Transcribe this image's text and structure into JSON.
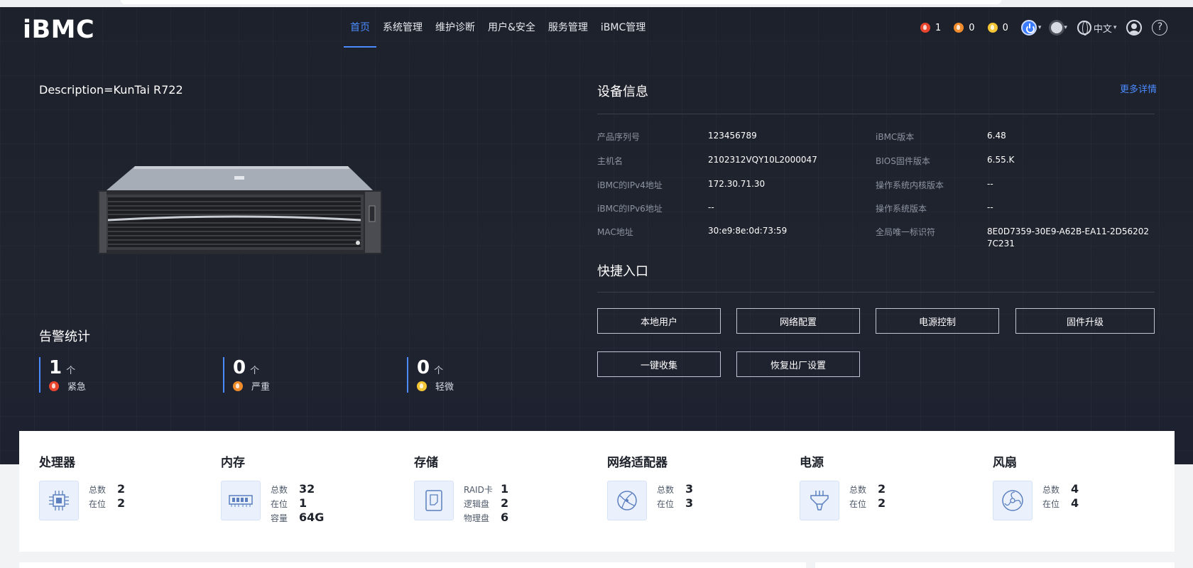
{
  "app": {
    "logo": "iBMC"
  },
  "nav": [
    {
      "label": "首页",
      "active": true
    },
    {
      "label": "系统管理"
    },
    {
      "label": "维护诊断"
    },
    {
      "label": "用户&安全"
    },
    {
      "label": "服务管理"
    },
    {
      "label": "iBMC管理"
    }
  ],
  "header_alarms": [
    {
      "count": "1",
      "color": "#e8452f"
    },
    {
      "count": "0",
      "color": "#f08c2b"
    },
    {
      "count": "0",
      "color": "#f4c534"
    }
  ],
  "header_tools": {
    "language": "中文",
    "help": "?"
  },
  "description": "Description=KunTai R722",
  "alarm_stats": {
    "title": "告警统计",
    "items": [
      {
        "count": "1",
        "unit": "个",
        "label": "紧急",
        "color": "#e8452f"
      },
      {
        "count": "0",
        "unit": "个",
        "label": "严重",
        "color": "#f08c2b"
      },
      {
        "count": "0",
        "unit": "个",
        "label": "轻微",
        "color": "#f4c534"
      }
    ]
  },
  "device_info": {
    "title": "设备信息",
    "more": "更多详情",
    "left": [
      {
        "label": "产品序列号",
        "value": "123456789"
      },
      {
        "label": "主机名",
        "value": "2102312VQY10L2000047"
      },
      {
        "label": "iBMC的IPv4地址",
        "value": "172.30.71.30"
      },
      {
        "label": "iBMC的IPv6地址",
        "value": "--"
      },
      {
        "label": "MAC地址",
        "value": "30:e9:8e:0d:73:59"
      }
    ],
    "right": [
      {
        "label": "iBMC版本",
        "value": "6.48"
      },
      {
        "label": "BIOS固件版本",
        "value": "6.55.K"
      },
      {
        "label": "操作系统内核版本",
        "value": "--"
      },
      {
        "label": "操作系统版本",
        "value": "--"
      },
      {
        "label": "全局唯一标识符",
        "value": "8E0D7359-30E9-A62B-EA11-2D562027C231"
      }
    ]
  },
  "quick_entry": {
    "title": "快捷入口",
    "buttons": [
      "本地用户",
      "网络配置",
      "电源控制",
      "固件升级",
      "一键收集",
      "恢复出厂设置"
    ]
  },
  "hardware": [
    {
      "title": "处理器",
      "icon": "cpu-icon",
      "stats": [
        {
          "k": "总数",
          "v": "2"
        },
        {
          "k": "在位",
          "v": "2"
        }
      ]
    },
    {
      "title": "内存",
      "icon": "memory-icon",
      "stats": [
        {
          "k": "总数",
          "v": "32"
        },
        {
          "k": "在位",
          "v": "1"
        },
        {
          "k": "容量",
          "v": "64G"
        }
      ]
    },
    {
      "title": "存储",
      "icon": "storage-icon",
      "stats": [
        {
          "k": "RAID卡",
          "v": "1"
        },
        {
          "k": "逻辑盘",
          "v": "2"
        },
        {
          "k": "物理盘",
          "v": "6"
        }
      ]
    },
    {
      "title": "网络适配器",
      "icon": "network-adapter-icon",
      "stats": [
        {
          "k": "总数",
          "v": "3"
        },
        {
          "k": "在位",
          "v": "3"
        }
      ]
    },
    {
      "title": "电源",
      "icon": "power-supply-icon",
      "stats": [
        {
          "k": "总数",
          "v": "2"
        },
        {
          "k": "在位",
          "v": "2"
        }
      ]
    },
    {
      "title": "风扇",
      "icon": "fan-icon",
      "stats": [
        {
          "k": "总数",
          "v": "4"
        },
        {
          "k": "在位",
          "v": "4"
        }
      ]
    }
  ]
}
